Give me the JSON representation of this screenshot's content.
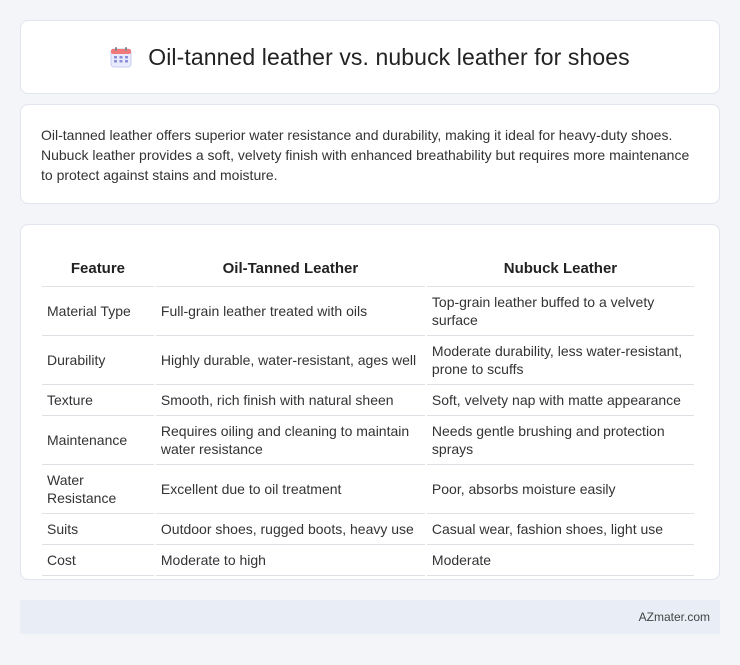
{
  "header": {
    "title": "Oil-tanned leather vs. nubuck leather for shoes",
    "icon": "calendar-icon"
  },
  "summary": {
    "text": "Oil-tanned leather offers superior water resistance and durability, making it ideal for heavy-duty shoes. Nubuck leather provides a soft, velvety finish with enhanced breathability but requires more maintenance to protect against stains and moisture."
  },
  "table": {
    "headers": [
      "Feature",
      "Oil-Tanned Leather",
      "Nubuck Leather"
    ],
    "rows": [
      [
        "Material Type",
        "Full-grain leather treated with oils",
        "Top-grain leather buffed to a velvety surface"
      ],
      [
        "Durability",
        "Highly durable, water-resistant, ages well",
        "Moderate durability, less water-resistant, prone to scuffs"
      ],
      [
        "Texture",
        "Smooth, rich finish with natural sheen",
        "Soft, velvety nap with matte appearance"
      ],
      [
        "Maintenance",
        "Requires oiling and cleaning to maintain water resistance",
        "Needs gentle brushing and protection sprays"
      ],
      [
        "Water Resistance",
        "Excellent due to oil treatment",
        "Poor, absorbs moisture easily"
      ],
      [
        "Suits",
        "Outdoor shoes, rugged boots, heavy use",
        "Casual wear, fashion shoes, light use"
      ],
      [
        "Cost",
        "Moderate to high",
        "Moderate"
      ]
    ]
  },
  "footer": {
    "text": "AZmater.com"
  }
}
